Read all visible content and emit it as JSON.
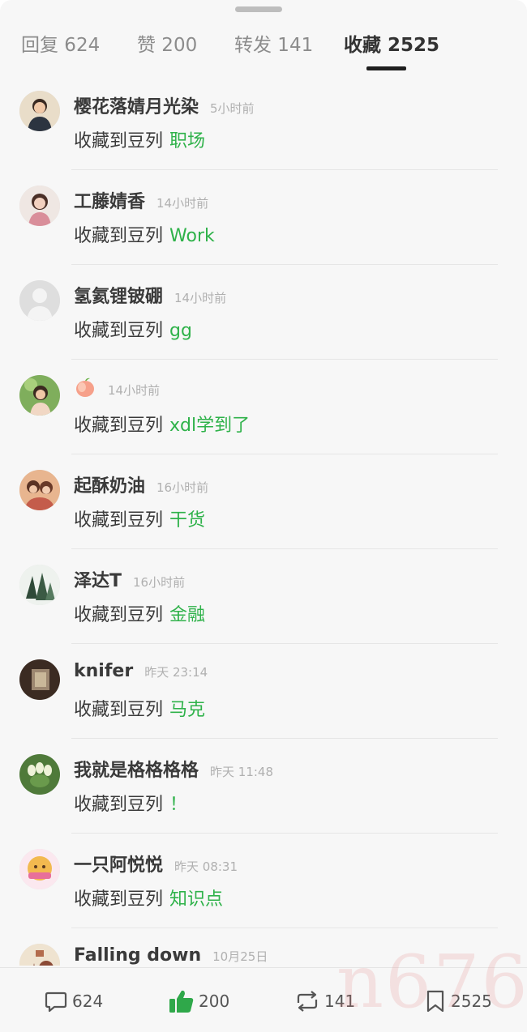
{
  "tabs": [
    {
      "label": "回复 624"
    },
    {
      "label": "赞 200"
    },
    {
      "label": "转发 141"
    },
    {
      "label": "收藏 2525",
      "active": true
    }
  ],
  "action_prefix": "收藏到豆列",
  "items": [
    {
      "name": "樱花落婧月光染",
      "time": "5小时前",
      "collection": "职场"
    },
    {
      "name": "工藤婧香",
      "time": "14小时前",
      "collection": "Work"
    },
    {
      "name": "氢氦锂铍硼",
      "time": "14小时前",
      "collection": "gg"
    },
    {
      "name": "",
      "time": "14小时前",
      "collection": "xdl学到了",
      "name_icon": "peach-emoji-icon"
    },
    {
      "name": "起酥奶油",
      "time": "16小时前",
      "collection": "干货"
    },
    {
      "name": "泽达T",
      "time": "16小时前",
      "collection": "金融"
    },
    {
      "name": "knifer",
      "time": "昨天 23:14",
      "collection": "马克"
    },
    {
      "name": "我就是格格格格",
      "time": "昨天 11:48",
      "collection": "！"
    },
    {
      "name": "一只阿悦悦",
      "time": "昨天 08:31",
      "collection": "知识点"
    },
    {
      "name": "Falling down",
      "time": "10月25日",
      "collection": ""
    }
  ],
  "bottom_bar": {
    "reply_count": "624",
    "like_count": "200",
    "repost_count": "141",
    "collect_count": "2525"
  },
  "watermark": "n676",
  "colors": {
    "accent_green": "#2fb24a",
    "like_green": "#2fa84a"
  },
  "icons": [
    "comment-icon",
    "thumbs-up-icon",
    "repost-icon",
    "bookmark-icon",
    "default-avatar-icon",
    "peach-emoji-icon"
  ]
}
